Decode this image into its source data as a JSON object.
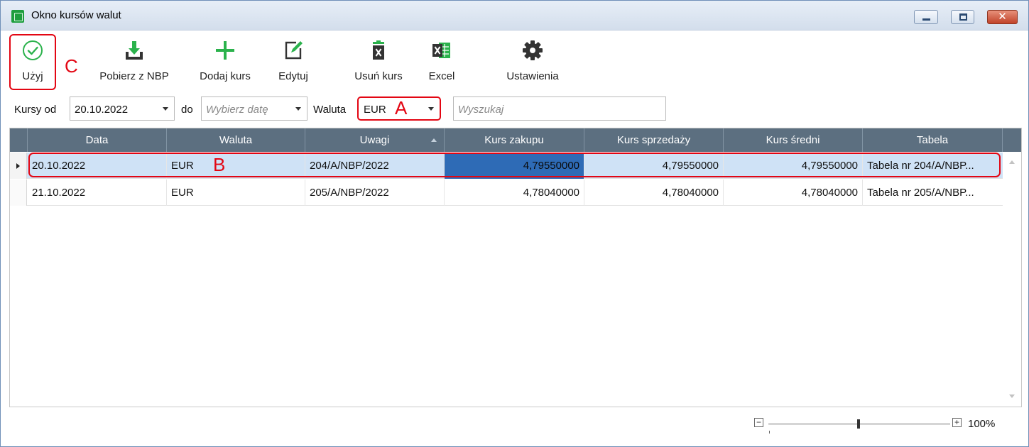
{
  "window": {
    "title": "Okno kursów walut"
  },
  "toolbar": {
    "buttons": [
      {
        "label": "Użyj",
        "icon": "check-circle-icon"
      },
      {
        "label": "Pobierz z NBP",
        "icon": "download-icon"
      },
      {
        "label": "Dodaj kurs",
        "icon": "plus-icon"
      },
      {
        "label": "Edytuj",
        "icon": "edit-icon"
      },
      {
        "label": "Usuń kurs",
        "icon": "trash-icon"
      },
      {
        "label": "Excel",
        "icon": "excel-icon"
      },
      {
        "label": "Ustawienia",
        "icon": "gear-icon"
      }
    ]
  },
  "filters": {
    "from_label": "Kursy od",
    "from_value": "20.10.2022",
    "to_label": "do",
    "to_placeholder": "Wybierz datę",
    "currency_label": "Waluta",
    "currency_value": "EUR",
    "search_placeholder": "Wyszukaj"
  },
  "annotations": {
    "a": "A",
    "b": "B",
    "c": "C"
  },
  "grid": {
    "columns": [
      "Data",
      "Waluta",
      "Uwagi",
      "Kurs zakupu",
      "Kurs sprzedaży",
      "Kurs średni",
      "Tabela"
    ],
    "rows": [
      {
        "data": "20.10.2022",
        "waluta": "EUR",
        "uwagi": "204/A/NBP/2022",
        "kurs_zakupu": "4,79550000",
        "kurs_sprzedazy": "4,79550000",
        "kurs_sredni": "4,79550000",
        "tabela": "Tabela nr 204/A/NBP..."
      },
      {
        "data": "21.10.2022",
        "waluta": "EUR",
        "uwagi": "205/A/NBP/2022",
        "kurs_zakupu": "4,78040000",
        "kurs_sprzedazy": "4,78040000",
        "kurs_sredni": "4,78040000",
        "tabela": "Tabela nr 205/A/NBP..."
      }
    ],
    "selected_row": 0
  },
  "zoom": {
    "minus": "−",
    "plus": "+",
    "percent": "100%",
    "level_percent": 100
  },
  "colors": {
    "accent_red": "#e30613",
    "header_bg": "#5c6f80",
    "selected_row": "#cfe2f6",
    "focused_cell": "#2e6bb6",
    "green_icon": "#2bb24c"
  }
}
